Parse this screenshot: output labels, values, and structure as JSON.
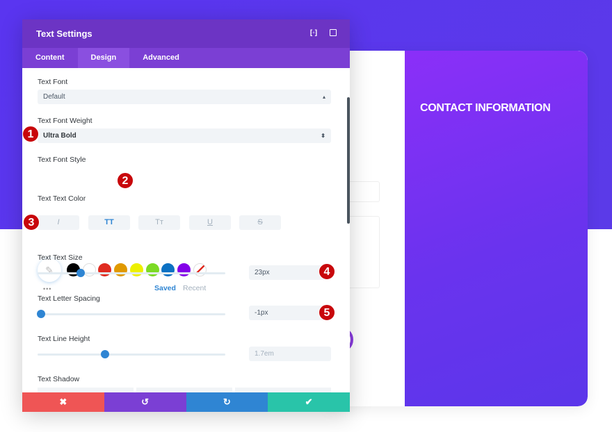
{
  "background": {
    "card_title": "CONTACT INFORMATION"
  },
  "modal": {
    "title": "Text Settings",
    "tabs": [
      {
        "label": "Content"
      },
      {
        "label": "Design",
        "active": true
      },
      {
        "label": "Advanced"
      }
    ],
    "font": {
      "label": "Text Font",
      "value": "Default"
    },
    "weight": {
      "label": "Text Font Weight",
      "value": "Ultra Bold"
    },
    "style": {
      "label": "Text Font Style",
      "buttons": [
        {
          "glyph": "I",
          "name": "italic"
        },
        {
          "glyph": "TT",
          "name": "uppercase",
          "active": true
        },
        {
          "glyph": "Tт",
          "name": "capitalize"
        },
        {
          "glyph": "U",
          "name": "underline"
        },
        {
          "glyph": "S",
          "name": "strikethrough"
        }
      ]
    },
    "color": {
      "label": "Text Text Color",
      "swatches": [
        "#000000",
        "#ffffff",
        "#e02b20",
        "#e09900",
        "#edf000",
        "#7cda24",
        "#0c71c3",
        "#8300e9"
      ],
      "saved": "Saved",
      "recent": "Recent",
      "more": "•••"
    },
    "size": {
      "label": "Text Text Size",
      "value": "23px",
      "slider_fraction": 0.23
    },
    "spacing": {
      "label": "Text Letter Spacing",
      "value": "-1px",
      "slider_fraction": 0.02
    },
    "line_height": {
      "label": "Text Line Height",
      "value": "1.7em",
      "slider_fraction": 0.36
    },
    "shadow": {
      "label": "Text Shadow"
    },
    "footer": {
      "cancel": "✖",
      "undo": "↺",
      "redo": "↻",
      "save": "✔"
    }
  },
  "badges": [
    "1",
    "2",
    "3",
    "4",
    "5"
  ],
  "colors": {
    "header": "#6c34c4",
    "tabs": "#7b3fd4",
    "cancel": "#ef5555",
    "undo": "#7b3fd4",
    "redo": "#2f85d3",
    "save": "#29c4a9",
    "accent": "#2f85d3",
    "badge": "#c8070b"
  }
}
